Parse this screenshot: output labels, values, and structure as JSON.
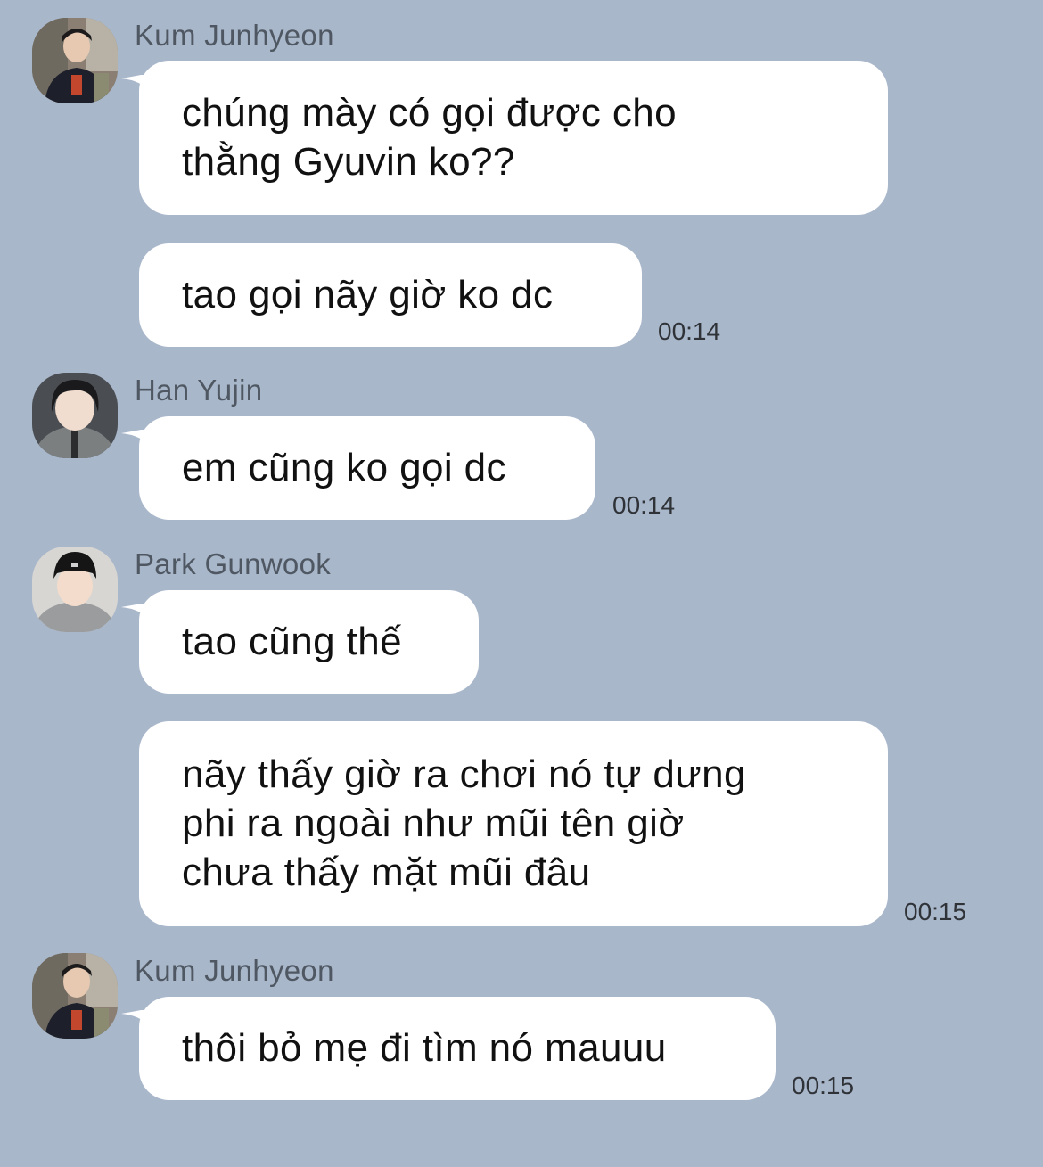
{
  "background_color": "#a9b7cb",
  "bubble_color": "#ffffff",
  "messages": [
    {
      "sender": "Kum Junhyeon",
      "avatar": "user-photo-junhyeon",
      "lines": [
        "chúng mày có gọi được cho",
        "thằng Gyuvin ko??"
      ],
      "time": ""
    },
    {
      "sender": "",
      "lines": [
        "tao gọi nãy giờ ko dc"
      ],
      "time": "00:14"
    },
    {
      "sender": "Han Yujin",
      "avatar": "user-photo-yujin",
      "lines": [
        "em cũng ko gọi dc"
      ],
      "time": "00:14"
    },
    {
      "sender": "Park Gunwook",
      "avatar": "user-photo-gunwook",
      "lines": [
        "tao cũng thế"
      ],
      "time": ""
    },
    {
      "sender": "",
      "lines": [
        "nãy thấy giờ ra chơi nó tự dưng",
        "phi ra ngoài như mũi tên giờ",
        "chưa thấy mặt mũi đâu"
      ],
      "time": "00:15"
    },
    {
      "sender": "Kum Junhyeon",
      "avatar": "user-photo-junhyeon",
      "lines": [
        "thôi bỏ mẹ đi tìm nó mauuu"
      ],
      "time": "00:15"
    }
  ]
}
